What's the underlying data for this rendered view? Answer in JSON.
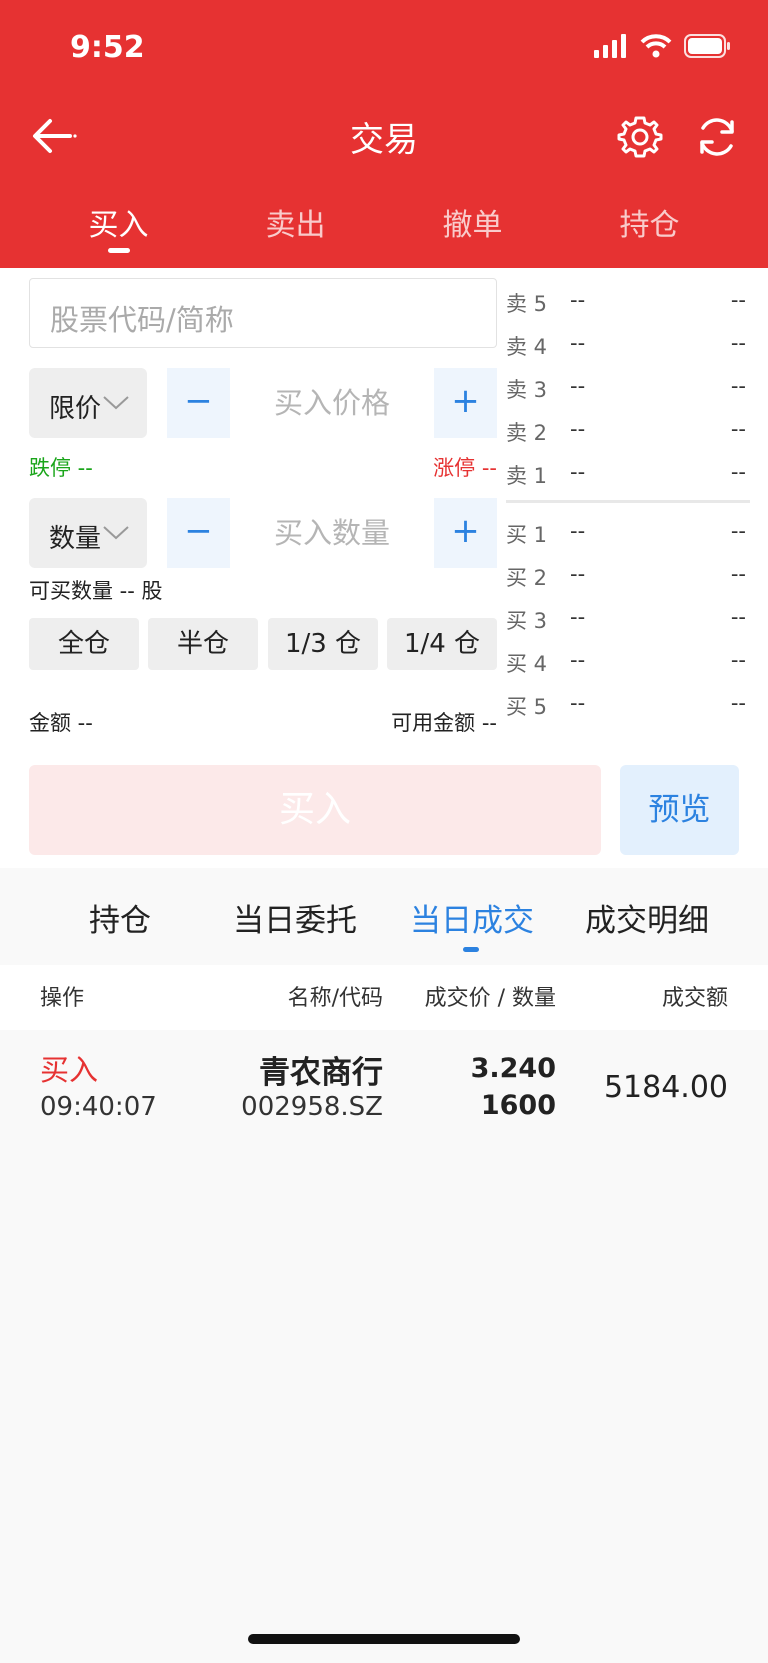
{
  "status_bar": {
    "time": "9:52"
  },
  "nav": {
    "title": "交易"
  },
  "main_tabs": [
    "买入",
    "卖出",
    "撤单",
    "持仓"
  ],
  "search": {
    "placeholder": "股票代码/简称"
  },
  "price": {
    "type_label": "限价",
    "minus": "−",
    "plus": "+",
    "placeholder": "买入价格"
  },
  "limits": {
    "down": "跌停 --",
    "up": "涨停 --"
  },
  "quantity": {
    "type_label": "数量",
    "minus": "−",
    "plus": "+",
    "placeholder": "买入数量"
  },
  "buyable": "可买数量 -- 股",
  "position_buttons": [
    "全仓",
    "半仓",
    "1/3 仓",
    "1/4 仓"
  ],
  "amount": "金额 --",
  "available": "可用金额 --",
  "order_book": {
    "asks": [
      {
        "level": "卖 5",
        "price": "--",
        "volume": "--"
      },
      {
        "level": "卖 4",
        "price": "--",
        "volume": "--"
      },
      {
        "level": "卖 3",
        "price": "--",
        "volume": "--"
      },
      {
        "level": "卖 2",
        "price": "--",
        "volume": "--"
      },
      {
        "level": "卖 1",
        "price": "--",
        "volume": "--"
      }
    ],
    "bids": [
      {
        "level": "买 1",
        "price": "--",
        "volume": "--"
      },
      {
        "level": "买 2",
        "price": "--",
        "volume": "--"
      },
      {
        "level": "买 3",
        "price": "--",
        "volume": "--"
      },
      {
        "level": "买 4",
        "price": "--",
        "volume": "--"
      },
      {
        "level": "买 5",
        "price": "--",
        "volume": "--"
      }
    ]
  },
  "actions": {
    "buy": "买入",
    "preview": "预览"
  },
  "sub_tabs": [
    "持仓",
    "当日委托",
    "当日成交",
    "成交明细"
  ],
  "table": {
    "headers": [
      "操作",
      "名称/代码",
      "成交价 / 数量",
      "成交额"
    ],
    "rows": [
      {
        "action": "买入",
        "time": "09:40:07",
        "name": "青农商行",
        "code": "002958.SZ",
        "price": "3.240",
        "quantity": "1600",
        "amount": "5184.00"
      }
    ]
  },
  "colors": {
    "brand_red": "#e63232",
    "accent_blue": "#2c82e0",
    "down_green": "#1aa51a"
  }
}
